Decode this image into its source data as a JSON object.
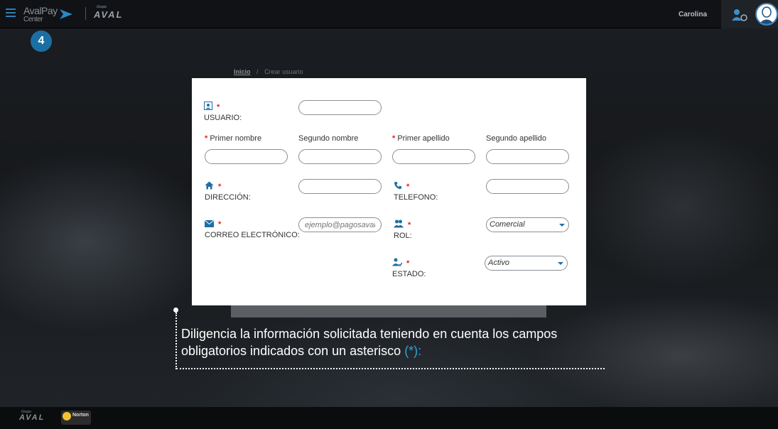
{
  "header": {
    "brand_line1": "AvalPay",
    "brand_line2": "Center",
    "group_label": "Grupo",
    "group_logo": "AVAL",
    "user_name": "Carolina"
  },
  "step_badge": "4",
  "breadcrumb": {
    "home": "Inicio",
    "separator": "/",
    "current": "Crear usuario"
  },
  "form": {
    "usuario_label": "USUARIO:",
    "primer_nombre_label": "Primer nombre",
    "segundo_nombre_label": "Segundo nombre",
    "primer_apellido_label": "Primer apellido",
    "segundo_apellido_label": "Segundo apellido",
    "direccion_label": "DIRECCIÓN:",
    "telefono_label": "TELEFONO:",
    "correo_label": "CORREO ELECTRÓNICO:",
    "correo_placeholder": "ejemplo@pagosaval.com",
    "rol_label": "ROL:",
    "rol_value": "Comercial",
    "estado_label": "ESTADO:",
    "estado_value": "Activo",
    "required_mark": "*"
  },
  "caption": {
    "text": "Diligencia la información solicitada teniendo en cuenta los campos obligatorios indicados con un asterisco ",
    "highlight": "(*):"
  },
  "footer": {
    "group_label": "Grupo",
    "logo": "AVAL",
    "norton": "Norton"
  },
  "colors": {
    "accent": "#1b6fa3",
    "required": "#e12121",
    "highlight": "#2aa3e0"
  }
}
